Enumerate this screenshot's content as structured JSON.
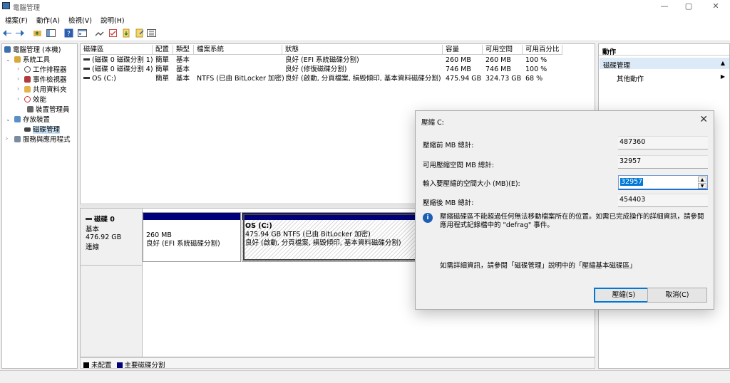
{
  "window": {
    "title": "電腦管理",
    "min": "—",
    "max": "▢",
    "close": "✕"
  },
  "menu": [
    "檔案(F)",
    "動作(A)",
    "檢視(V)",
    "說明(H)"
  ],
  "tree": {
    "root": "電腦管理 (本機)",
    "system_tools": "系統工具",
    "task_scheduler": "工作排程器",
    "event_viewer": "事件檢視器",
    "shared_folders": "共用資料夾",
    "performance": "效能",
    "device_manager": "裝置管理員",
    "storage": "存放裝置",
    "disk_management": "磁碟管理",
    "services": "服務與應用程式"
  },
  "volumes": {
    "headers": [
      "磁碟區",
      "配置",
      "類型",
      "檔案系統",
      "狀態",
      "容量",
      "可用空間",
      "可用百分比"
    ],
    "rows": [
      [
        "(磁碟 0 磁碟分割 1)",
        "簡單",
        "基本",
        "",
        "良好 (EFI 系統磁碟分割)",
        "260 MB",
        "260 MB",
        "100 %"
      ],
      [
        "(磁碟 0 磁碟分割 4)",
        "簡單",
        "基本",
        "",
        "良好 (修復磁碟分割)",
        "746 MB",
        "746 MB",
        "100 %"
      ],
      [
        "OS (C:)",
        "簡單",
        "基本",
        "NTFS (已由 BitLocker 加密)",
        "良好 (啟動, 分頁檔案, 損毀傾印, 基本資料磁碟分割)",
        "475.94 GB",
        "324.73 GB",
        "68 %"
      ]
    ]
  },
  "disk": {
    "name": "磁碟 0",
    "type": "基本",
    "size": "476.92 GB",
    "status": "連線",
    "p1_size": "260 MB",
    "p1_status": "良好 (EFI 系統磁碟分割)",
    "p2_name": "OS  (C:)",
    "p2_size": "475.94 GB NTFS (已由 BitLocker 加密)",
    "p2_status": "良好 (啟動, 分頁檔案, 損毀傾印, 基本資料磁碟分割)"
  },
  "legend": {
    "unallocated": "未配置",
    "primary": "主要磁碟分割"
  },
  "actions": {
    "header": "動作",
    "section": "磁碟管理",
    "more": "其他動作"
  },
  "dialog": {
    "title": "壓縮 C:",
    "total_label": "壓縮前 MB 總計:",
    "total_value": "487360",
    "available_label": "可用壓縮空間 MB 總計:",
    "available_value": "32957",
    "enter_label": "輸入要壓縮的空間大小 (MB)(E):",
    "enter_value": "32957",
    "after_label": "壓縮後 MB 總計:",
    "after_value": "454403",
    "info": "壓縮磁碟區不能超過任何無法移動檔案所在的位置。如需已完成操作的詳細資訊，請參閱應用程式記錄檔中的 \"defrag\" 事件。",
    "more_info": "如需詳細資訊，請參閱「磁碟管理」說明中的「壓縮基本磁碟區」",
    "ok": "壓縮(S)",
    "cancel": "取消(C)"
  },
  "colors": {
    "primary_partition": "#00007a",
    "unallocated": "#000000",
    "selection": "#0078d7"
  }
}
